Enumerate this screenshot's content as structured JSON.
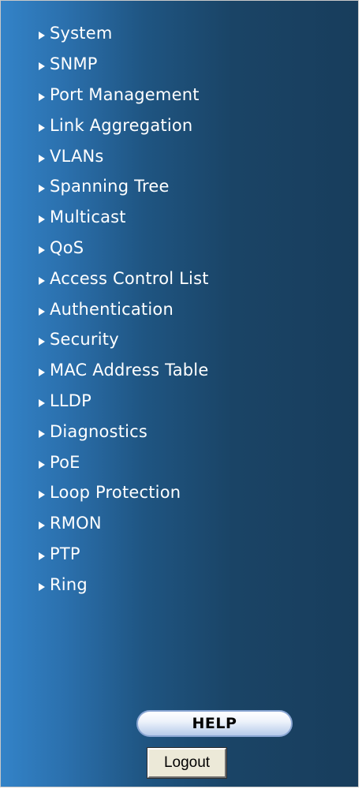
{
  "menu": {
    "items": [
      {
        "label": "System"
      },
      {
        "label": "SNMP"
      },
      {
        "label": "Port Management"
      },
      {
        "label": "Link Aggregation"
      },
      {
        "label": "VLANs"
      },
      {
        "label": "Spanning Tree"
      },
      {
        "label": "Multicast"
      },
      {
        "label": "QoS"
      },
      {
        "label": "Access Control List"
      },
      {
        "label": "Authentication"
      },
      {
        "label": "Security"
      },
      {
        "label": "MAC Address Table"
      },
      {
        "label": "LLDP"
      },
      {
        "label": "Diagnostics"
      },
      {
        "label": "PoE"
      },
      {
        "label": "Loop Protection"
      },
      {
        "label": "RMON"
      },
      {
        "label": "PTP"
      },
      {
        "label": "Ring"
      }
    ],
    "arrow_icon": "triangle-right-icon"
  },
  "help": {
    "label": "HELP"
  },
  "logout": {
    "label": "Logout"
  },
  "colors": {
    "background_light": "#3383c8",
    "background_dark": "#183d5c",
    "menu_text": "#ffffff"
  }
}
